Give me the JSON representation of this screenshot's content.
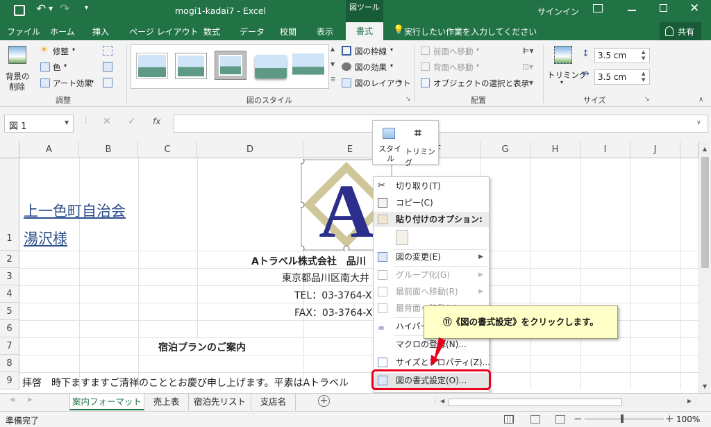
{
  "app": {
    "window_title": "mogi1-kadai7 - Excel",
    "context_tool": "図ツール",
    "signin": "サインイン",
    "share": "共有",
    "tell_me": "実行したい作業を入力してください"
  },
  "tabs": [
    "ファイル",
    "ホーム",
    "挿入",
    "ページ レイアウト",
    "数式",
    "データ",
    "校閲",
    "表示",
    "書式"
  ],
  "ribbon": {
    "adjust": {
      "remove_bg": [
        "背景の",
        "削除"
      ],
      "corrections": "修整",
      "color": "色",
      "artistic": "アート効果",
      "group": "調整"
    },
    "styles": {
      "border": "図の枠線",
      "effects": "図の効果",
      "layout": "図のレイアウト",
      "group": "図のスタイル"
    },
    "arrange": {
      "forward": "前面へ移動",
      "backward": "背面へ移動",
      "selection": "オブジェクトの選択と表示",
      "group": "配置"
    },
    "size": {
      "crop": "トリミング",
      "height": "3.5 cm",
      "width": "3.5 cm",
      "group": "サイズ"
    }
  },
  "formula_bar": {
    "name_box": "図 1",
    "fx": "fx",
    "value": ""
  },
  "columns": [
    "A",
    "B",
    "C",
    "D",
    "E",
    "F",
    "G",
    "H",
    "I",
    "J"
  ],
  "rows": [
    "1",
    "2",
    "3",
    "4",
    "5",
    "6",
    "7",
    "8",
    "9"
  ],
  "cells": {
    "a1_line1": "上一色町自治会",
    "a1_line2": "湯沢様",
    "d2": "Aトラベル株式会社　品川",
    "d3": "東京都品川区南大井",
    "d4": "TEL：03-3764-X",
    "d5": "FAX：03-3764-X",
    "c7": "宿泊プランのご案内",
    "a9": "拝啓　時下ますますご清祥のこととお慶び申し上げます。平素はAトラベル"
  },
  "logo_letter": "A",
  "mini_toolbar": {
    "style": [
      "スタイ",
      "ル"
    ],
    "crop": "トリミング"
  },
  "context_menu": {
    "cut": "切り取り(T)",
    "copy": "コピー(C)",
    "paste_options": "貼り付けのオプション:",
    "change_picture": "図の変更(E)",
    "group": "グループ化(G)",
    "bring_front": "最前面へ移動(R)",
    "send_back": "最背面へ移動(K)",
    "hyperlink": "ハイパーリンク(I)...",
    "assign_macro": "マクロの登録(N)...",
    "size_props": "サイズとプロパティ(Z)...",
    "format_picture": "図の書式設定(O)..."
  },
  "callout": "⑪《図の書式設定》をクリックします。",
  "sheet_tabs": [
    "案内フォーマット",
    "売上表",
    "宿泊先リスト",
    "支店名"
  ],
  "status": {
    "ready": "準備完了",
    "zoom": "100%"
  },
  "colors": {
    "excel_green": "#217346",
    "logo_blue": "#2c2e8c",
    "logo_khaki": "#cfc79a",
    "highlight_red": "#e8001c"
  }
}
